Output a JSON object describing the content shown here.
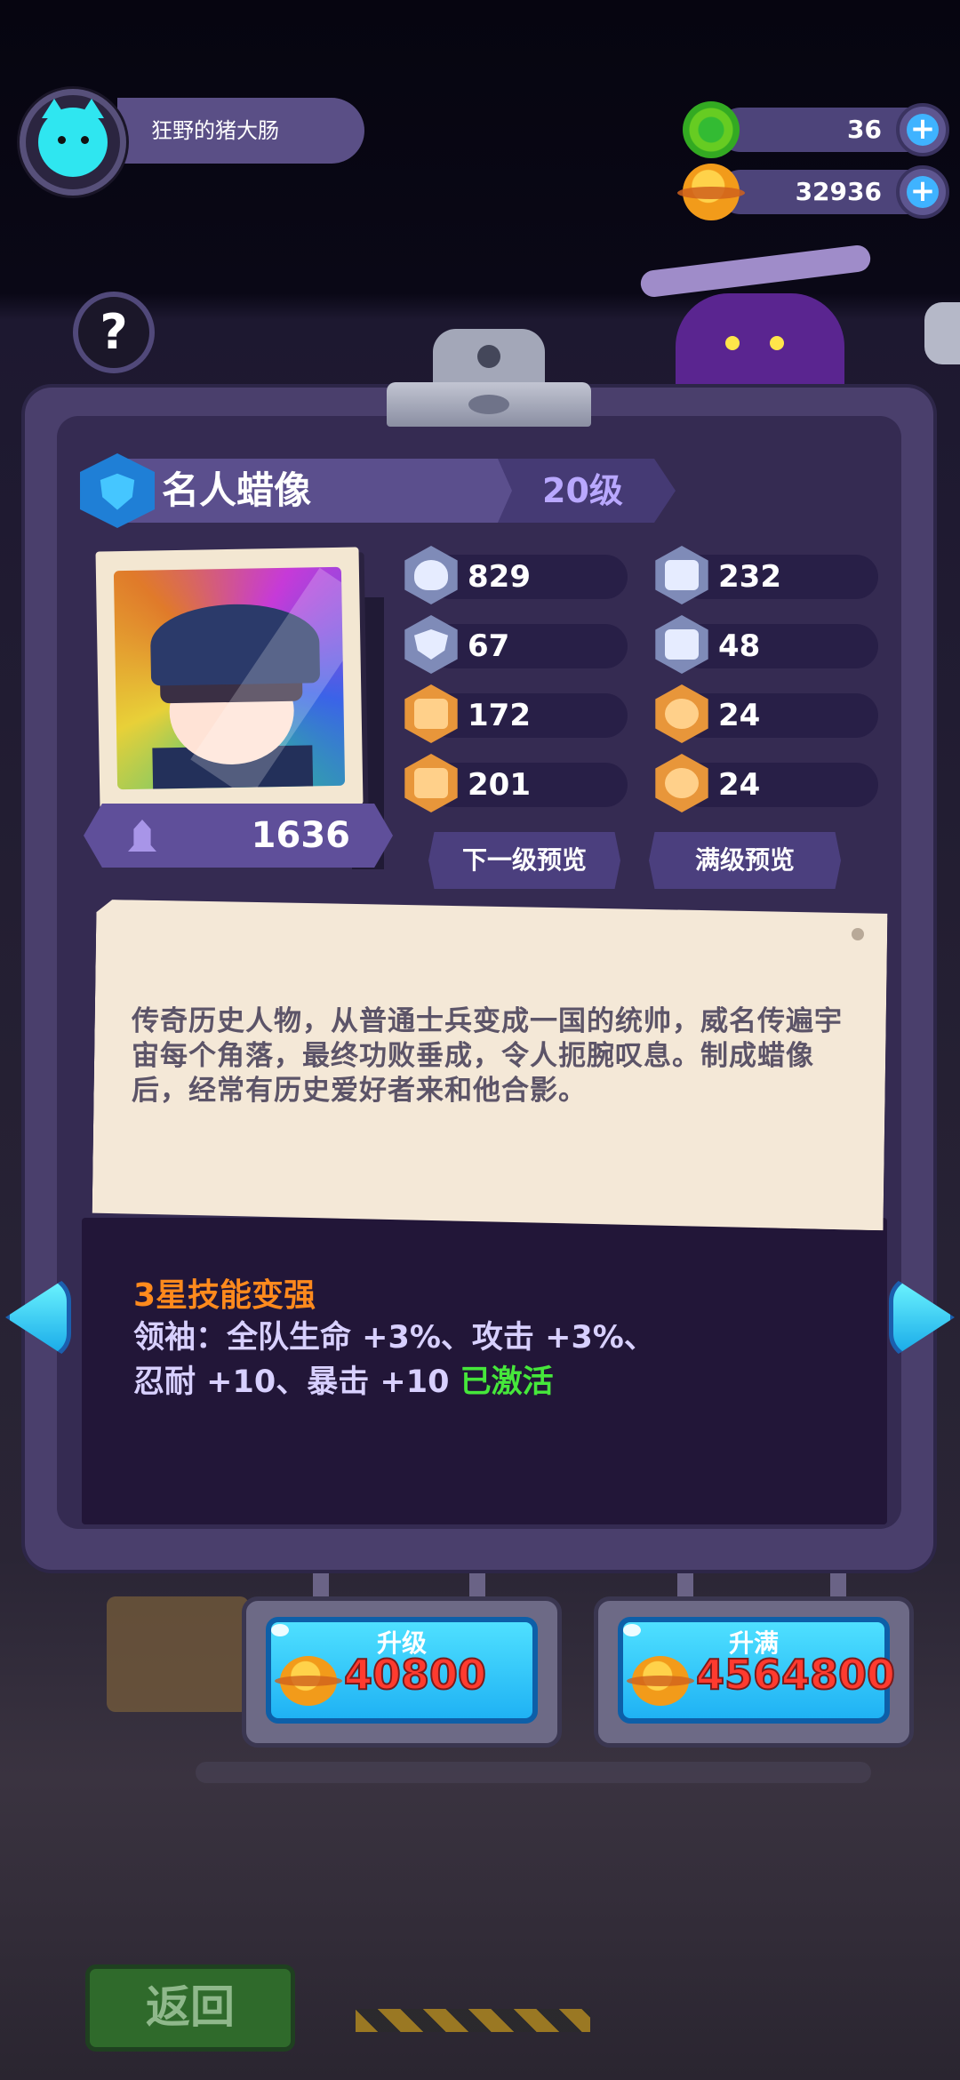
{
  "player": {
    "name": "狂野的猪大肠"
  },
  "currencies": [
    {
      "icon": "green-donut-gem-icon",
      "value": "36"
    },
    {
      "icon": "gold-planet-coin-icon",
      "value": "32936"
    }
  ],
  "card": {
    "name": "名人蜡像",
    "level": "20级",
    "power": "1636",
    "stats_left": [
      {
        "icon": "heart-icon",
        "value": "829"
      },
      {
        "icon": "shield-icon",
        "value": "67"
      },
      {
        "icon": "boot-icon",
        "value": "172"
      },
      {
        "icon": "muscle-icon",
        "value": "201"
      }
    ],
    "stats_right": [
      {
        "icon": "rocket-icon",
        "value": "232"
      },
      {
        "icon": "anchor-icon",
        "value": "48"
      },
      {
        "icon": "smile-icon",
        "value": "24"
      },
      {
        "icon": "brain-icon",
        "value": "24"
      }
    ],
    "next_preview_label": "下一级预览",
    "max_preview_label": "满级预览",
    "description": "传奇历史人物，从普通士兵变成一国的统帅，威名传遍宇宙每个角落，最终功败垂成，令人扼腕叹息。制成蜡像后，经常有历史爱好者来和他合影。",
    "skill_title": "3星技能变强",
    "skill_line1": "领袖：全队生命 +3%、攻击 +3%、",
    "skill_line2": "忍耐 +10、暴击 +10 ",
    "skill_status": "已激活"
  },
  "actions": {
    "upgrade": {
      "label": "升级",
      "cost": "40800"
    },
    "upgrade_max": {
      "label": "升满",
      "cost": "4564800"
    }
  },
  "footer": {
    "back_label": "返回"
  },
  "colors": {
    "accent_cyan": "#2fe6f0",
    "skill_orange": "#ff8a1d",
    "active_green": "#46e73b",
    "cost_red": "#ff3b2f"
  }
}
